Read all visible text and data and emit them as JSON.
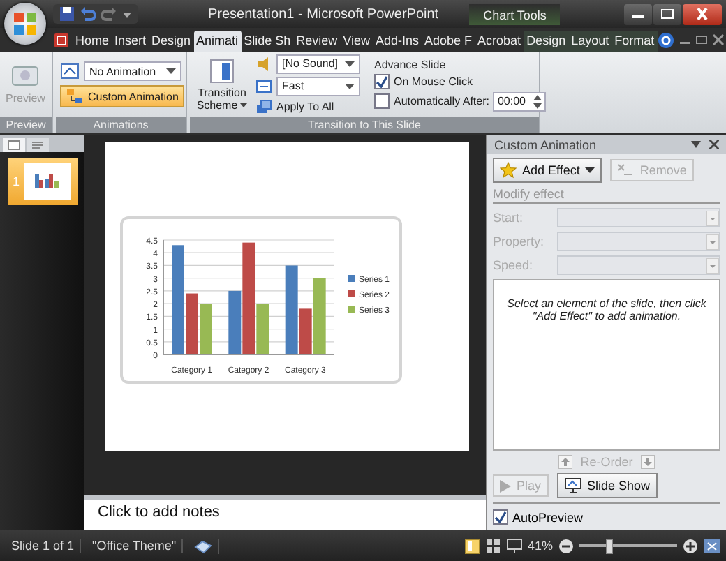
{
  "title_bar": {
    "title": "Presentation1 - Microsoft PowerPoint",
    "context_label": "Chart Tools"
  },
  "tabs": [
    {
      "label": "Home",
      "selected": false,
      "contextual": false
    },
    {
      "label": "Insert",
      "selected": false,
      "contextual": false
    },
    {
      "label": "Design",
      "selected": false,
      "contextual": false
    },
    {
      "label": "Animati",
      "selected": true,
      "contextual": false
    },
    {
      "label": "Slide Sh",
      "selected": false,
      "contextual": false
    },
    {
      "label": "Review",
      "selected": false,
      "contextual": false
    },
    {
      "label": "View",
      "selected": false,
      "contextual": false
    },
    {
      "label": "Add-Ins",
      "selected": false,
      "contextual": false
    },
    {
      "label": "Adobe F",
      "selected": false,
      "contextual": false
    },
    {
      "label": "Acrobat",
      "selected": false,
      "contextual": false
    },
    {
      "label": "Design",
      "selected": false,
      "contextual": true
    },
    {
      "label": "Layout",
      "selected": false,
      "contextual": true
    },
    {
      "label": "Format",
      "selected": false,
      "contextual": true
    }
  ],
  "ribbon": {
    "preview": {
      "label": "Preview",
      "group": "Preview",
      "disabled": true
    },
    "animations": {
      "dropdown": "No Animation",
      "custom_animation": {
        "label": "Custom Animation",
        "selected": true
      },
      "group": "Animations"
    },
    "transition": {
      "scheme": "Transition Scheme",
      "sound": "[No Sound]",
      "speed": "Fast",
      "apply_all": "Apply To All",
      "advance_heading": "Advance Slide",
      "advance_options": [
        {
          "label": "On Mouse Click",
          "checked": true
        },
        {
          "label": "Automatically After:",
          "checked": false
        }
      ],
      "time": "00:00",
      "group": "Transition to This Slide"
    }
  },
  "thumbnails": [
    {
      "number": "1",
      "selected": true
    }
  ],
  "chart_data": {
    "type": "bar",
    "categories": [
      "Category 1",
      "Category 2",
      "Category 3"
    ],
    "series": [
      {
        "name": "Series 1",
        "color": "#4a7ebb",
        "values": [
          4.3,
          2.5,
          3.5
        ]
      },
      {
        "name": "Series 2",
        "color": "#be4b48",
        "values": [
          2.4,
          4.4,
          1.8
        ]
      },
      {
        "name": "Series 3",
        "color": "#98b954",
        "values": [
          2,
          2,
          3
        ]
      }
    ],
    "grid": true,
    "legend": true,
    "ylim": [
      0,
      4.5
    ],
    "yticks": [
      0,
      0.5,
      1,
      1.5,
      2,
      2.5,
      3,
      3.5,
      4,
      4.5
    ]
  },
  "notes": "Click to add notes",
  "task_pane": {
    "title": "Custom Animation",
    "add_effect": "Add Effect",
    "remove": {
      "label": "Remove",
      "disabled": true
    },
    "section": "Modify effect",
    "fields": [
      {
        "label": "Start:",
        "disabled": true
      },
      {
        "label": "Property:",
        "disabled": true
      },
      {
        "label": "Speed:",
        "disabled": true
      }
    ],
    "message": "Select an element of the slide, then click \"Add Effect\" to add animation.",
    "reorder": "Re-Order",
    "play": {
      "label": "Play",
      "disabled": true
    },
    "slide_show": "Slide Show",
    "autopreview": {
      "label": "AutoPreview",
      "checked": true
    }
  },
  "status_bar": {
    "slide": "Slide 1 of 1",
    "theme": "\"Office Theme\"",
    "zoom": "41%",
    "zoom_slider": {
      "level": 0.3
    }
  }
}
